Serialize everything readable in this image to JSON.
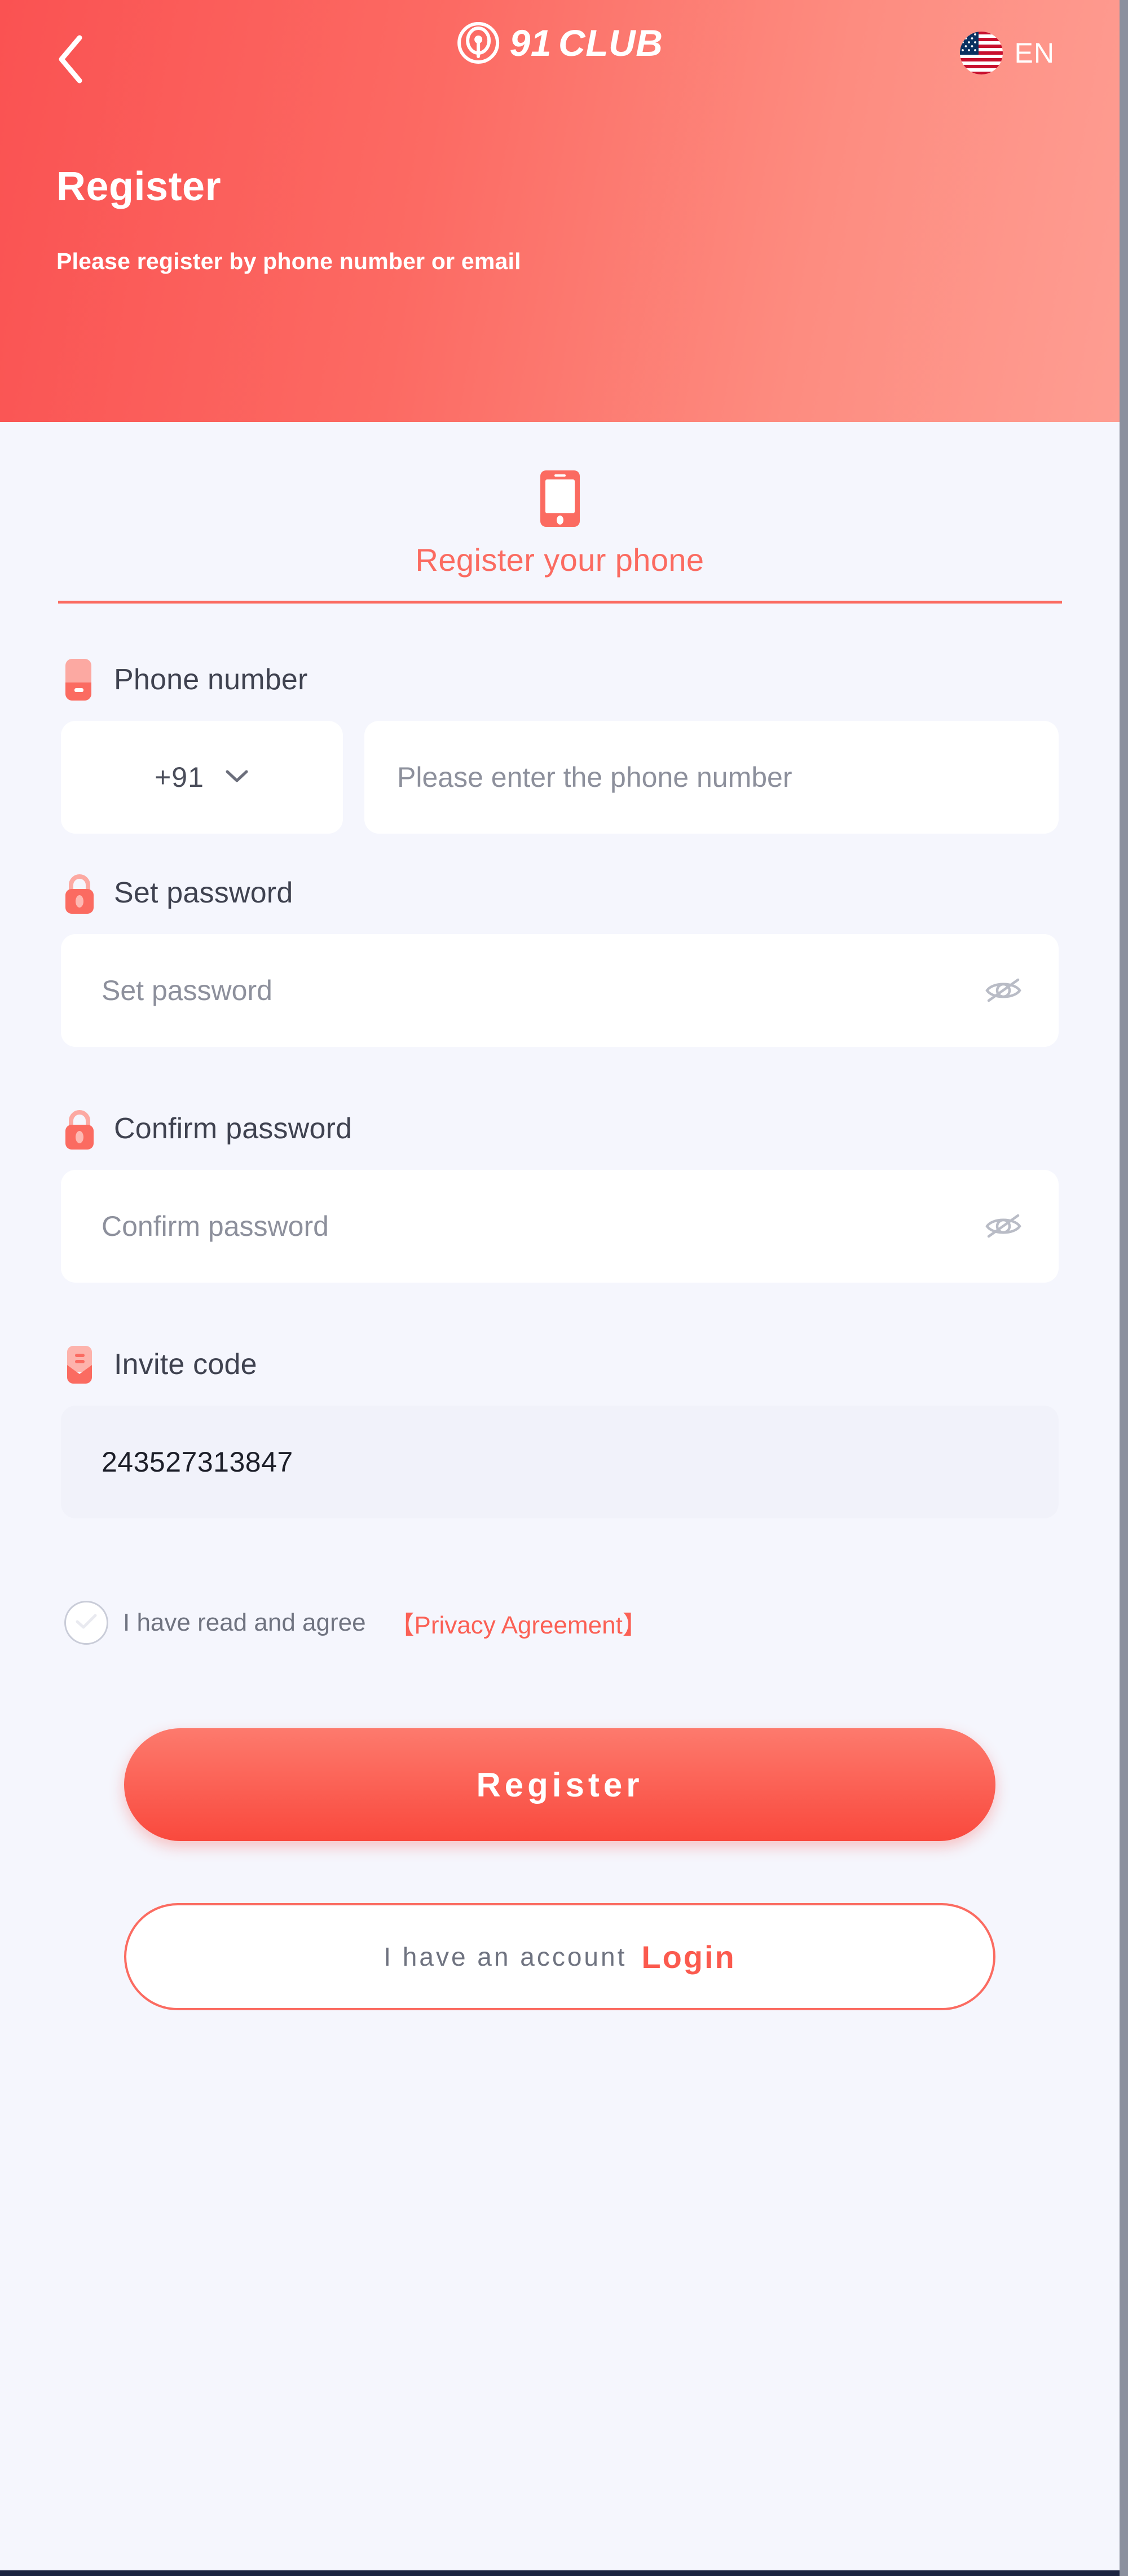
{
  "colors": {
    "brand_red": "#fb5f53",
    "header_gradient_start": "#fa5252",
    "header_gradient_end": "#fe9d92",
    "page_background": "#f5f6fd",
    "label_text": "#3f4250",
    "placeholder_text": "#8d909c",
    "scrollbar": "#8b909e"
  },
  "header": {
    "back_icon": "chevron-left-icon",
    "logo_icon": "target-circle-icon",
    "brand_number": "91",
    "brand_word": "CLUB",
    "language_flag": "us-flag-icon",
    "language_label": "EN",
    "title": "Register",
    "subtitle": "Please register by phone number or email"
  },
  "tab": {
    "icon": "mobile-phone-icon",
    "label": "Register your phone"
  },
  "form": {
    "phone": {
      "icon": "phone-card-icon",
      "label": "Phone number",
      "country_code": "+91",
      "dropdown_icon": "chevron-down-icon",
      "placeholder": "Please enter the phone number",
      "value": ""
    },
    "set_password": {
      "icon": "lock-icon",
      "label": "Set password",
      "placeholder": "Set password",
      "value": "",
      "toggle_icon": "eye-off-icon"
    },
    "confirm_password": {
      "icon": "lock-icon",
      "label": "Confirm password",
      "placeholder": "Confirm password",
      "value": "",
      "toggle_icon": "eye-off-icon"
    },
    "invite_code": {
      "icon": "invite-envelope-icon",
      "label": "Invite code",
      "value": "243527313847"
    }
  },
  "agreement": {
    "checkbox_icon": "check-circle-icon",
    "checked": false,
    "text": "I have read and agree",
    "link": "【Privacy Agreement】"
  },
  "actions": {
    "register_label": "Register",
    "login_prefix": "I have an account",
    "login_label": "Login"
  }
}
